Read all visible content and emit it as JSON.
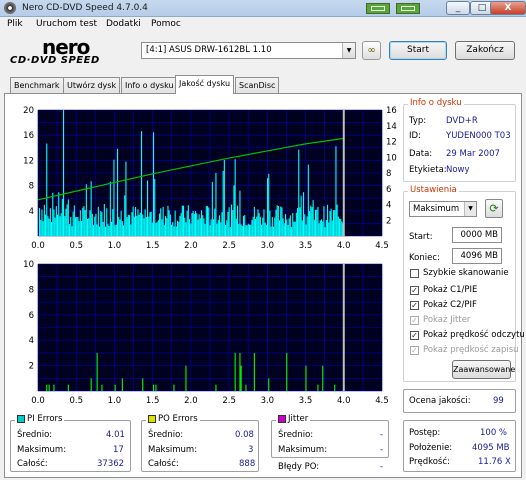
{
  "window": {
    "title": "Nero CD-DVD Speed 4.7.0.4",
    "close": "X",
    "minimize": "_",
    "maximize": "□"
  },
  "menu": [
    "Plik",
    "Uruchom test",
    "Dodatki",
    "Pomoc"
  ],
  "logo": {
    "top": "nero",
    "bottom": "CD·DVD SPEED"
  },
  "drive": {
    "selected": "[4:1]  ASUS DRW-1612BL 1.10"
  },
  "buttons": {
    "start": "Start",
    "exit": "Zakończ",
    "advanced": "Zaawansowane"
  },
  "tabs": [
    "Benchmark",
    "Utwórz dysk",
    "Info o dysku",
    "Jakość dysku",
    "ScanDisc"
  ],
  "active_tab": 3,
  "disc_info": {
    "title": "Info o dysku",
    "rows": [
      {
        "label": "Typ:",
        "value": "DVD+R"
      },
      {
        "label": "ID:",
        "value": "YUDEN000 T03"
      },
      {
        "label": "Data:",
        "value": "29 Mar 2007"
      },
      {
        "label": "Etykieta:",
        "value": "Nowy"
      }
    ]
  },
  "settings": {
    "title": "Ustawienia",
    "speed": "Maksimum",
    "start_label": "Start:",
    "start_value": "0000 MB",
    "end_label": "Koniec:",
    "end_value": "4096 MB",
    "checks": [
      {
        "label": "Szybkie skanowanie",
        "checked": false,
        "enabled": true
      },
      {
        "label": "Pokaż C1/PIE",
        "checked": true,
        "enabled": true
      },
      {
        "label": "Pokaż C2/PIF",
        "checked": true,
        "enabled": true
      },
      {
        "label": "Pokaż Jitter",
        "checked": true,
        "enabled": false
      },
      {
        "label": "Pokaż prędkość odczytu",
        "checked": true,
        "enabled": true
      },
      {
        "label": "Pokaż prędkość zapisu",
        "checked": true,
        "enabled": false
      }
    ]
  },
  "quality": {
    "label": "Ocena jakości:",
    "value": "99"
  },
  "progress": {
    "rows": [
      {
        "label": "Postęp:",
        "value": "100 %"
      },
      {
        "label": "Położenie:",
        "value": "4095 MB"
      },
      {
        "label": "Prędkość:",
        "value": "11.76 X"
      }
    ]
  },
  "pi_errors": {
    "title": "PI Errors",
    "color": "#00cccc",
    "rows": [
      {
        "label": "Średnio:",
        "value": "4.01"
      },
      {
        "label": "Maksimum:",
        "value": "17"
      },
      {
        "label": "Całość:",
        "value": "37362"
      }
    ]
  },
  "po_errors": {
    "title": "PO Errors",
    "color": "#e0e000",
    "rows": [
      {
        "label": "Średnio:",
        "value": "0.08"
      },
      {
        "label": "Maksimum:",
        "value": "3"
      },
      {
        "label": "Całość:",
        "value": "888"
      }
    ]
  },
  "jitter": {
    "title": "Jitter",
    "color": "#cc00cc",
    "rows": [
      {
        "label": "Średnio:",
        "value": "-"
      },
      {
        "label": "Maksimum:",
        "value": "-"
      }
    ],
    "po_fail_label": "Błędy PO:",
    "po_fail_value": "-"
  },
  "colors": {
    "plot_bg": "#000020",
    "grid": "#0000b0",
    "pi": "#00ffff",
    "po": "#00ff00",
    "speed": "#00c000",
    "cursor": "#c0c0c0"
  },
  "chart_data": [
    {
      "type": "area",
      "x_ticks": [
        "0.0",
        "0.5",
        "1.0",
        "1.5",
        "2.0",
        "2.5",
        "3.0",
        "3.5",
        "4.0",
        "4.5"
      ],
      "xlim": [
        0,
        4.5
      ],
      "ylim_left": [
        0,
        20
      ],
      "y_ticks_left": [
        "20",
        "16",
        "12",
        "8",
        "4"
      ],
      "ylim_right": [
        0,
        16
      ],
      "y_ticks_right": [
        "16",
        "14",
        "12",
        "10",
        "8",
        "6",
        "4",
        "2"
      ],
      "series": [
        {
          "type": "bar",
          "axis": "left",
          "x_end": 4.0,
          "mean": 4.01,
          "max": 17
        },
        {
          "type": "line",
          "axis": "right",
          "x": [
            0.0,
            0.5,
            1.0,
            1.5,
            2.0,
            2.5,
            3.0,
            3.5,
            4.0
          ],
          "values": [
            4.6,
            5.7,
            6.8,
            7.9,
            8.9,
            9.9,
            10.8,
            11.7,
            12.4
          ]
        }
      ],
      "scan_end": 4.0
    },
    {
      "type": "bar",
      "x_ticks": [
        "0.0",
        "0.5",
        "1.0",
        "1.5",
        "2.0",
        "2.5",
        "3.0",
        "3.5",
        "4.0",
        "4.5"
      ],
      "xlim": [
        0,
        4.5
      ],
      "ylim": [
        0,
        10
      ],
      "y_ticks": [
        "10",
        "8",
        "6",
        "4",
        "2"
      ],
      "series": [
        {
          "type": "bar",
          "x_end": 4.0,
          "mean": 0.08,
          "max": 3
        }
      ],
      "scan_end": 4.0
    }
  ]
}
